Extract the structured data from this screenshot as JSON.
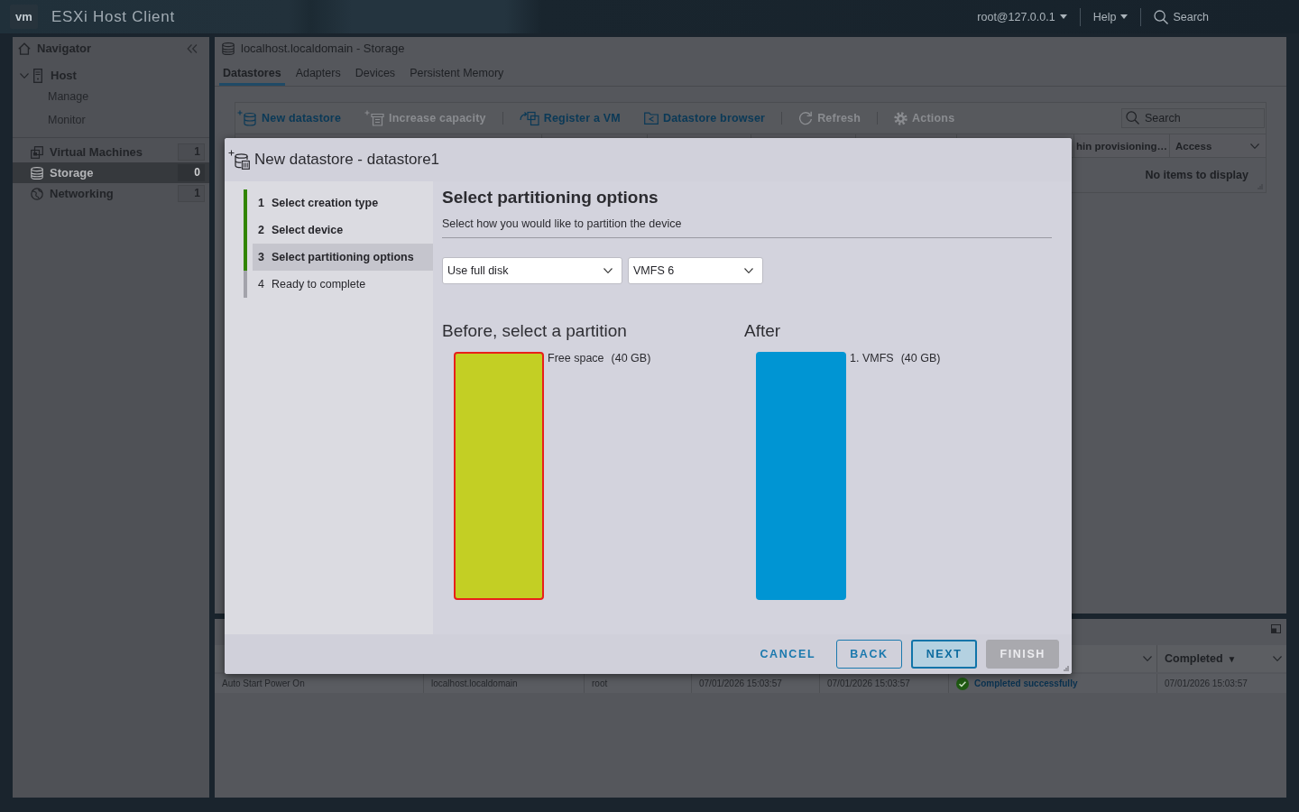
{
  "header": {
    "logo": "vm",
    "title": "ESXi Host Client",
    "user_menu": "root@127.0.0.1",
    "help_menu": "Help",
    "search": "Search"
  },
  "navigator": {
    "title": "Navigator",
    "host": {
      "label": "Host",
      "expanded": true,
      "selected": false,
      "children": [
        {
          "label": "Manage",
          "selected": false
        },
        {
          "label": "Monitor",
          "selected": false
        }
      ]
    },
    "items": [
      {
        "label": "Virtual Machines",
        "kind": "vms",
        "count": "1",
        "selected": false
      },
      {
        "label": "Storage",
        "kind": "storage",
        "count": "0",
        "selected": true
      },
      {
        "label": "Networking",
        "kind": "networking",
        "count": "1",
        "selected": false
      }
    ]
  },
  "storage": {
    "title": "localhost.localdomain - Storage",
    "tabs": [
      {
        "label": "Datastores",
        "selected": true
      },
      {
        "label": "Adapters",
        "selected": false
      },
      {
        "label": "Devices",
        "selected": false
      },
      {
        "label": "Persistent Memory",
        "selected": false
      }
    ],
    "toolbar": [
      [
        {
          "label": "New datastore",
          "kind": "new",
          "disabled": false
        },
        {
          "label": "Increase capacity",
          "kind": "increase",
          "disabled": true
        }
      ],
      [
        {
          "label": "Register a VM",
          "kind": "register",
          "disabled": false
        },
        {
          "label": "Datastore browser",
          "kind": "browser",
          "disabled": false
        }
      ],
      [
        {
          "label": "Refresh",
          "kind": "refresh",
          "disabled": true
        }
      ],
      [
        {
          "label": "Actions",
          "kind": "actions",
          "disabled": true
        }
      ]
    ],
    "search": {
      "placeholder": "Search"
    },
    "table": {
      "columns": [
        {
          "label": "hin provisioning…"
        },
        {
          "label": "Access"
        }
      ],
      "empty_message": "No items to display"
    }
  },
  "tasks": {
    "columns": [
      null,
      null,
      null,
      null,
      null,
      {},
      {
        "label": "Completed",
        "sort_mark": "▼"
      }
    ],
    "rows": [
      {
        "cells": [
          {
            "text": "Auto Start Power On",
            "kind": "text"
          },
          {
            "text": "localhost.localdomain",
            "kind": "text"
          },
          {
            "text": "root",
            "kind": "text"
          },
          {
            "text": "07/01/2026 15:03:57",
            "kind": "text"
          },
          {
            "text": "07/01/2026 15:03:57",
            "kind": "text"
          },
          {
            "text": "Completed successfully",
            "kind": "success"
          },
          {
            "text": "07/01/2026 15:03:57",
            "kind": "text"
          }
        ]
      }
    ]
  },
  "dialog": {
    "title": "New datastore - datastore1",
    "steps": [
      {
        "number": "1",
        "label": "Select creation type",
        "visited": true,
        "selected": false
      },
      {
        "number": "2",
        "label": "Select device",
        "visited": true,
        "selected": false
      },
      {
        "number": "3",
        "label": "Select partitioning options",
        "visited": true,
        "selected": true
      },
      {
        "number": "4",
        "label": "Ready to complete",
        "visited": false,
        "selected": false
      }
    ],
    "page": {
      "heading": "Select partitioning options",
      "description": "Select how you would like to partition the device",
      "selects": [
        {
          "value": "Use full disk"
        },
        {
          "value": "VMFS 6"
        }
      ],
      "layouts": [
        {
          "title": "Before, select a partition",
          "partitions": [
            {
              "name": "Free space",
              "size": "(40 GB)",
              "color": "#c3cf24",
              "selected": true
            }
          ]
        },
        {
          "title": "After",
          "partitions": [
            {
              "name": "1. VMFS",
              "size": "(40 GB)",
              "color": "#0095d3",
              "selected": false
            }
          ]
        }
      ]
    },
    "buttons": [
      {
        "label": "CANCEL",
        "kind": "link",
        "disabled": false
      },
      {
        "label": "BACK",
        "kind": "outline",
        "disabled": false
      },
      {
        "label": "NEXT",
        "kind": "primary",
        "disabled": false
      },
      {
        "label": "FINISH",
        "kind": "solid",
        "disabled": true
      }
    ]
  }
}
